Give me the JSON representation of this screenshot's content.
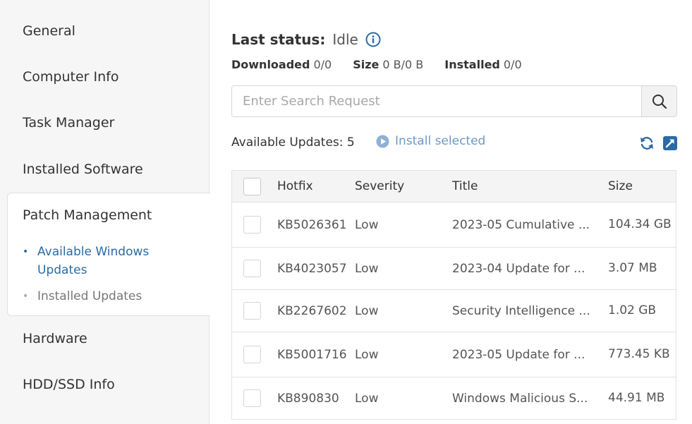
{
  "sidebar": {
    "items": [
      {
        "label": "General"
      },
      {
        "label": "Computer Info"
      },
      {
        "label": "Task Manager"
      },
      {
        "label": "Installed Software"
      },
      {
        "label": "Patch Management"
      },
      {
        "label": "Hardware"
      },
      {
        "label": "HDD/SSD Info"
      }
    ],
    "patch_submenu": [
      {
        "label": "Available Windows Updates",
        "active": true
      },
      {
        "label": "Installed Updates",
        "active": false
      }
    ],
    "bullet": "•"
  },
  "status": {
    "label": "Last status:",
    "value": "Idle",
    "downloaded_label": "Downloaded",
    "downloaded_value": "0/0",
    "size_label": "Size",
    "size_value": "0 B/0 B",
    "installed_label": "Installed",
    "installed_value": "0/0"
  },
  "search": {
    "placeholder": "Enter Search Request",
    "value": ""
  },
  "toolbar": {
    "available_updates": "Available Updates: 5",
    "install_selected": "Install selected"
  },
  "table": {
    "columns": [
      "Hotfix",
      "Severity",
      "Title",
      "Size"
    ],
    "rows": [
      {
        "hotfix": "KB5026361",
        "severity": "Low",
        "title": "2023-05 Cumulative ...",
        "size": "104.34 GB"
      },
      {
        "hotfix": "KB4023057",
        "severity": "Low",
        "title": "2023-04 Update for ...",
        "size": "3.07 MB"
      },
      {
        "hotfix": "KB2267602",
        "severity": "Low",
        "title": "Security Intelligence ...",
        "size": "1.02 GB"
      },
      {
        "hotfix": "KB5001716",
        "severity": "Low",
        "title": "2023-05 Update for ...",
        "size": "773.45 KB"
      },
      {
        "hotfix": "KB890830",
        "severity": "Low",
        "title": "Windows Malicious S...",
        "size": "44.91 MB"
      }
    ]
  },
  "icons": {
    "info": "info-circle-icon",
    "search": "magnifier-icon",
    "install": "play-circle-icon",
    "refresh": "refresh-icon",
    "export": "open-external-icon"
  },
  "colors": {
    "accent": "#2a6aa5",
    "install_link": "#6d9ac4",
    "sidebar_bg": "#f6f6f6"
  }
}
